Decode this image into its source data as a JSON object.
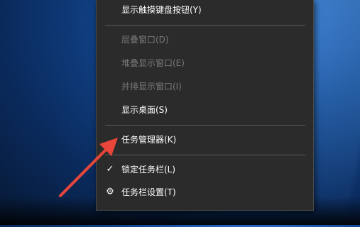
{
  "menu": {
    "items": [
      {
        "label": "显示触摸键盘按钮(Y)"
      },
      {
        "label": "层叠窗口(D)"
      },
      {
        "label": "堆叠显示窗口(E)"
      },
      {
        "label": "并排显示窗口(I)"
      },
      {
        "label": "显示桌面(S)"
      },
      {
        "label": "任务管理器(K)"
      },
      {
        "label": "锁定任务栏(L)",
        "checked": true
      },
      {
        "label": "任务栏设置(T)",
        "icon": "gear-icon"
      }
    ]
  },
  "colors": {
    "menu_background": "#2b2b2b",
    "disabled_text": "#7a7a7a",
    "arrow": "#e8463a"
  }
}
